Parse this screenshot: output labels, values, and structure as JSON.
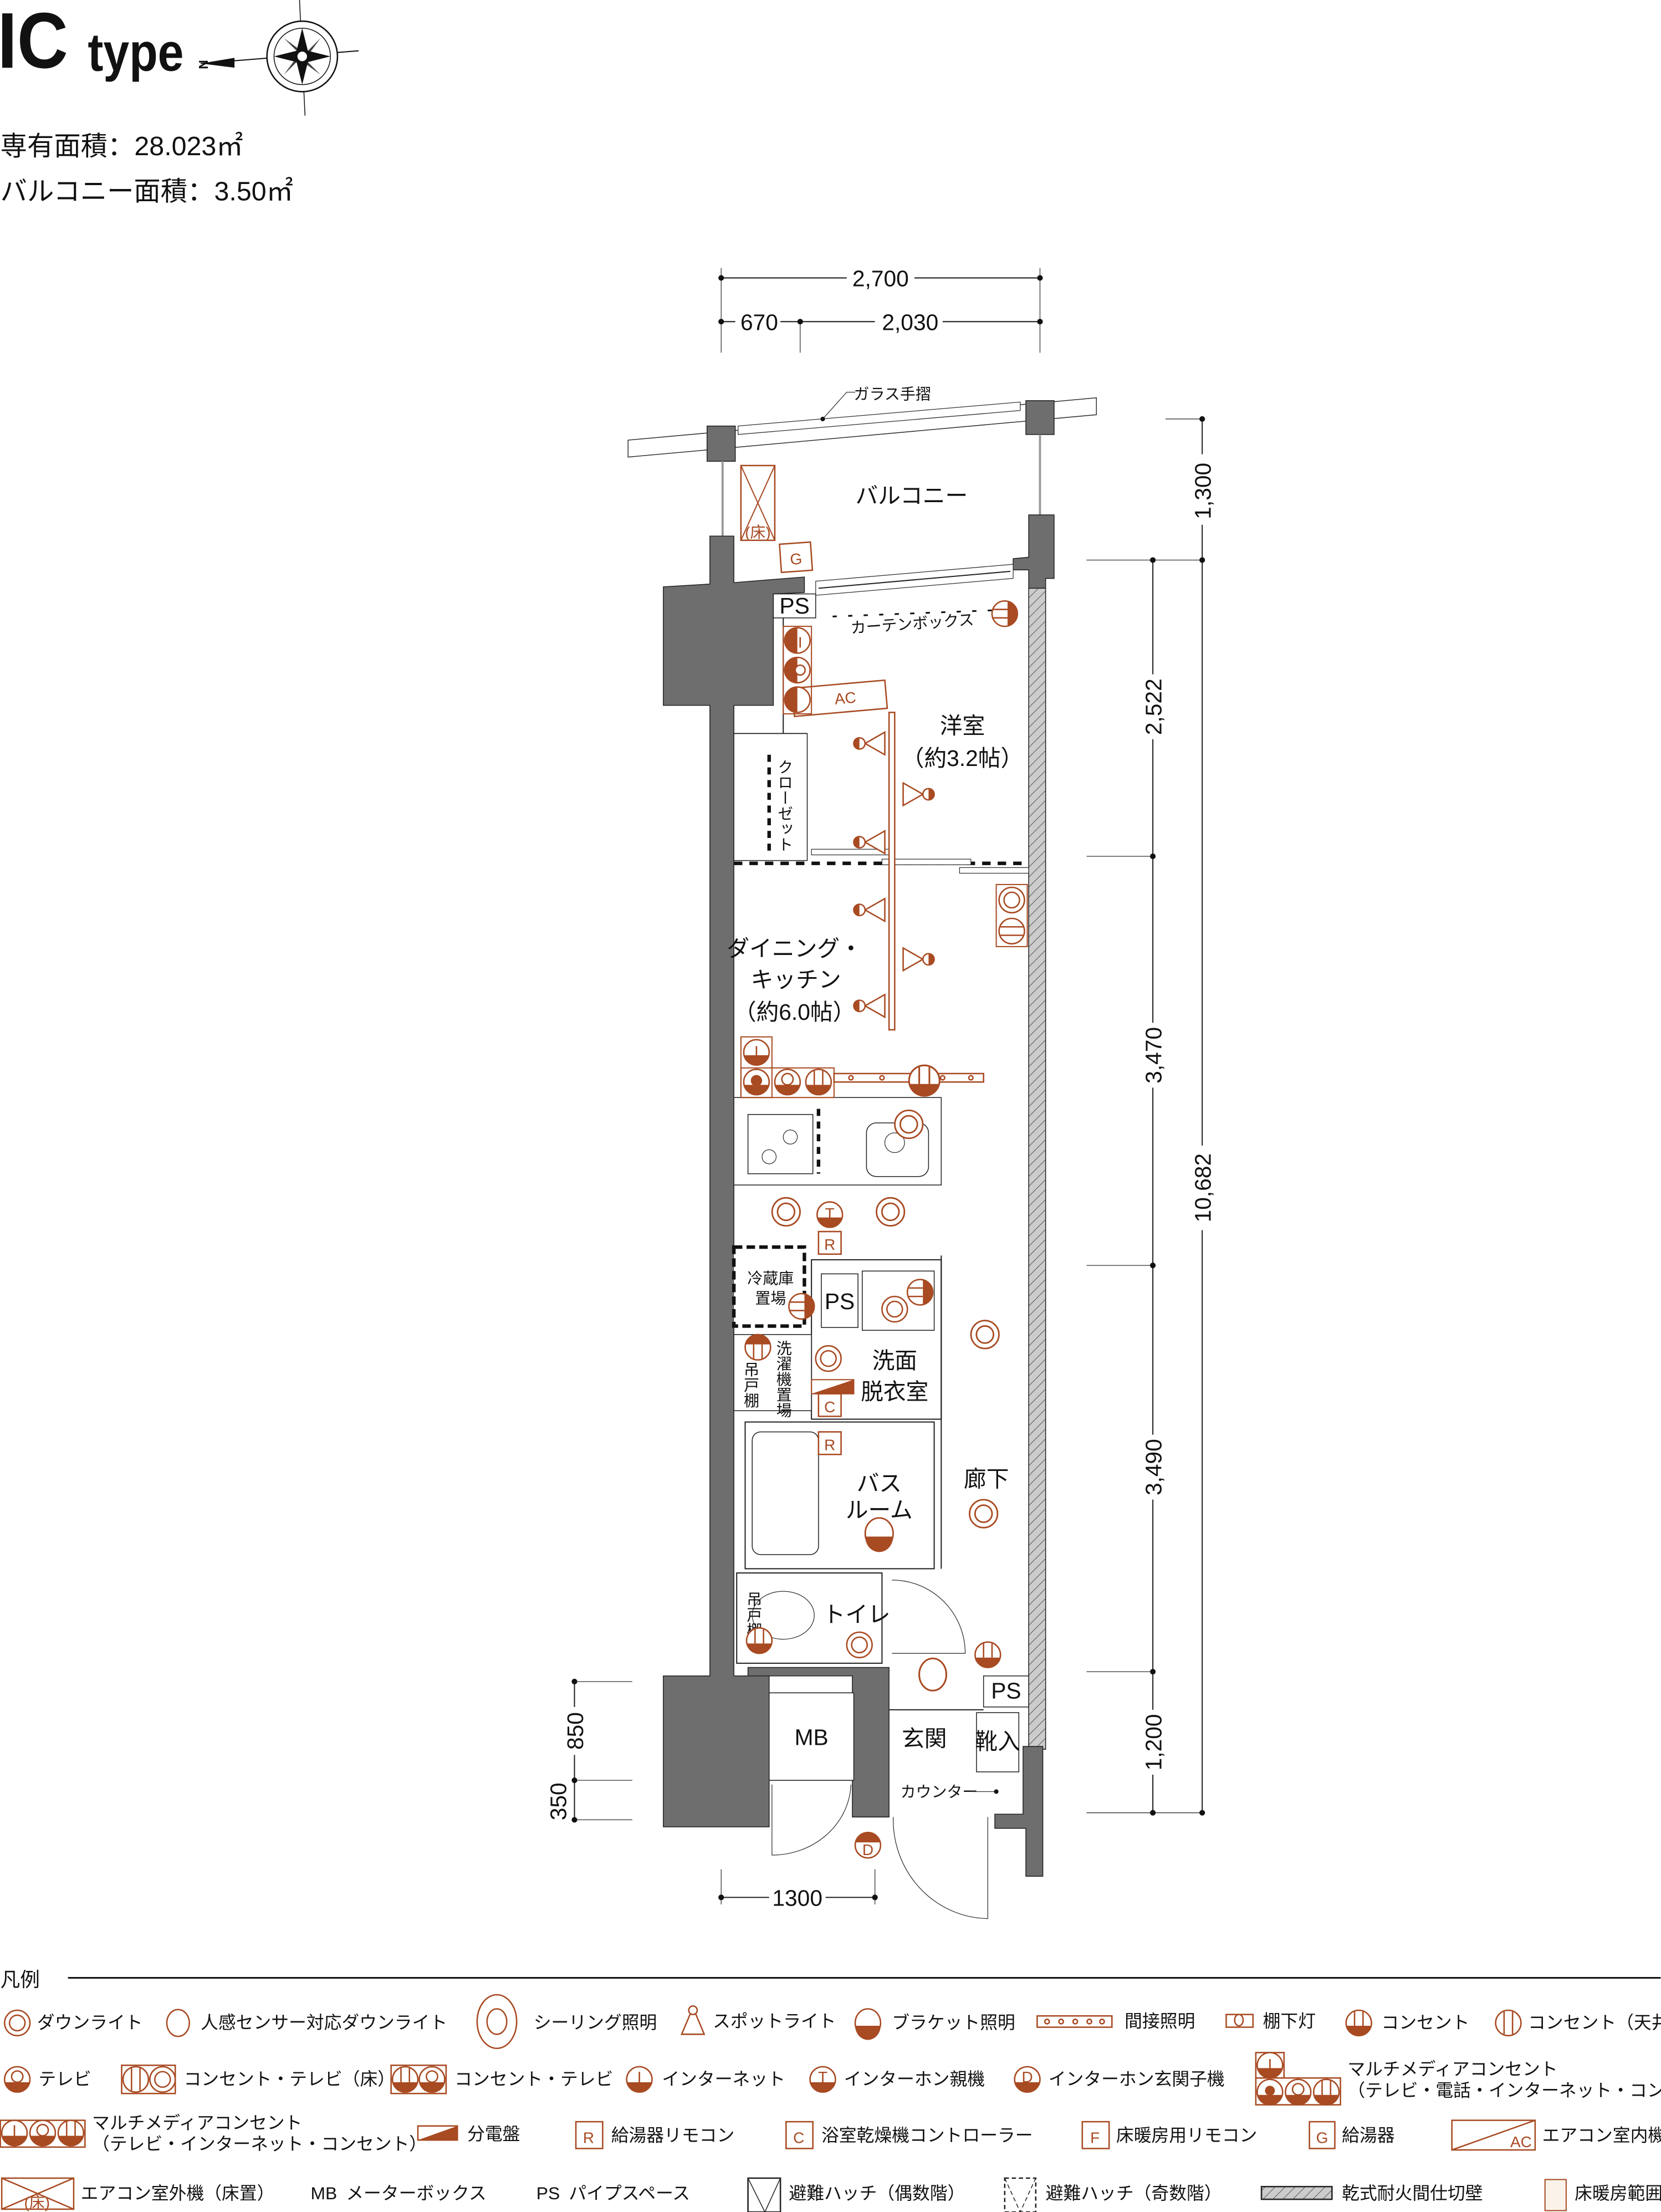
{
  "header": {
    "type_letters": "IC",
    "type_word": "type",
    "compass_label": "N",
    "exclusive_area": "専有面積：28.023㎡",
    "balcony_area": "バルコニー面積：3.50㎡"
  },
  "colors": {
    "accent": "#a84a22",
    "wall": "#6e6e6e",
    "partition_hatch": "#cccccc",
    "floor_heating": "#fbf3ea"
  },
  "dimensions": {
    "top_total": "2,700",
    "top_left": "670",
    "top_right": "2,030",
    "right_outer": [
      "1,300",
      "10,682"
    ],
    "right_inner": [
      "2,522",
      "3,470",
      "3,490",
      "1,200"
    ],
    "left": [
      "850",
      "350"
    ],
    "bottom": "1300"
  },
  "plan": {
    "glass_railing": "ガラス手摺",
    "balcony": "バルコニー",
    "curtain_box": "カーテンボックス",
    "western_room": [
      "洋室",
      "（約3.2帖）"
    ],
    "closet": "クローゼット",
    "dining_kitchen": [
      "ダイニング・",
      "キッチン",
      "（約6.0帖）"
    ],
    "fridge": [
      "冷蔵庫",
      "置場"
    ],
    "ps": "PS",
    "washroom": [
      "洗面",
      "脱衣室"
    ],
    "laundry": "洗濯機置場",
    "hanging_shelf": "吊戸棚",
    "bathroom": [
      "バス",
      "ルーム"
    ],
    "corridor": "廊下",
    "toilet": "トイレ",
    "mb": "MB",
    "entrance": "玄関",
    "shoe_storage": "靴入",
    "counter": "カウンター",
    "symbols": {
      "ac": "AC",
      "g": "G",
      "floor": "(床)",
      "i": "I",
      "t": "T",
      "r": "R",
      "c": "C",
      "d": "D",
      "f": "F"
    }
  },
  "legend": {
    "title": "凡例",
    "row1": [
      "ダウンライト",
      "人感センサー対応ダウンライト",
      "シーリング照明",
      "スポットライト",
      "ブラケット照明",
      "間接照明",
      "棚下灯",
      "コンセント",
      "コンセント（天井）"
    ],
    "row2": [
      "テレビ",
      "コンセント・テレビ（床）",
      "コンセント・テレビ",
      "インターネット",
      "インターホン親機",
      "インターホン玄関子機"
    ],
    "multimedia_full": [
      "マルチメディアコンセント",
      "（テレビ・電話・インターネット・コンセント）"
    ],
    "multimedia_basic": [
      "マルチメディアコンセント",
      "（テレビ・インターネット・コンセント）"
    ],
    "row3": [
      "分電盤",
      "給湯器リモコン",
      "浴室乾燥機コントローラー",
      "床暖房用リモコン",
      "給湯器",
      "エアコン室内機"
    ],
    "row4": [
      "エアコン室外機（床置）",
      "メーターボックス",
      "パイプスペース",
      "避難ハッチ（偶数階）",
      "避難ハッチ（奇数階）",
      "乾式耐火間仕切壁",
      "床暖房範囲"
    ],
    "abbr": {
      "mb": "MB",
      "ps": "PS"
    }
  }
}
